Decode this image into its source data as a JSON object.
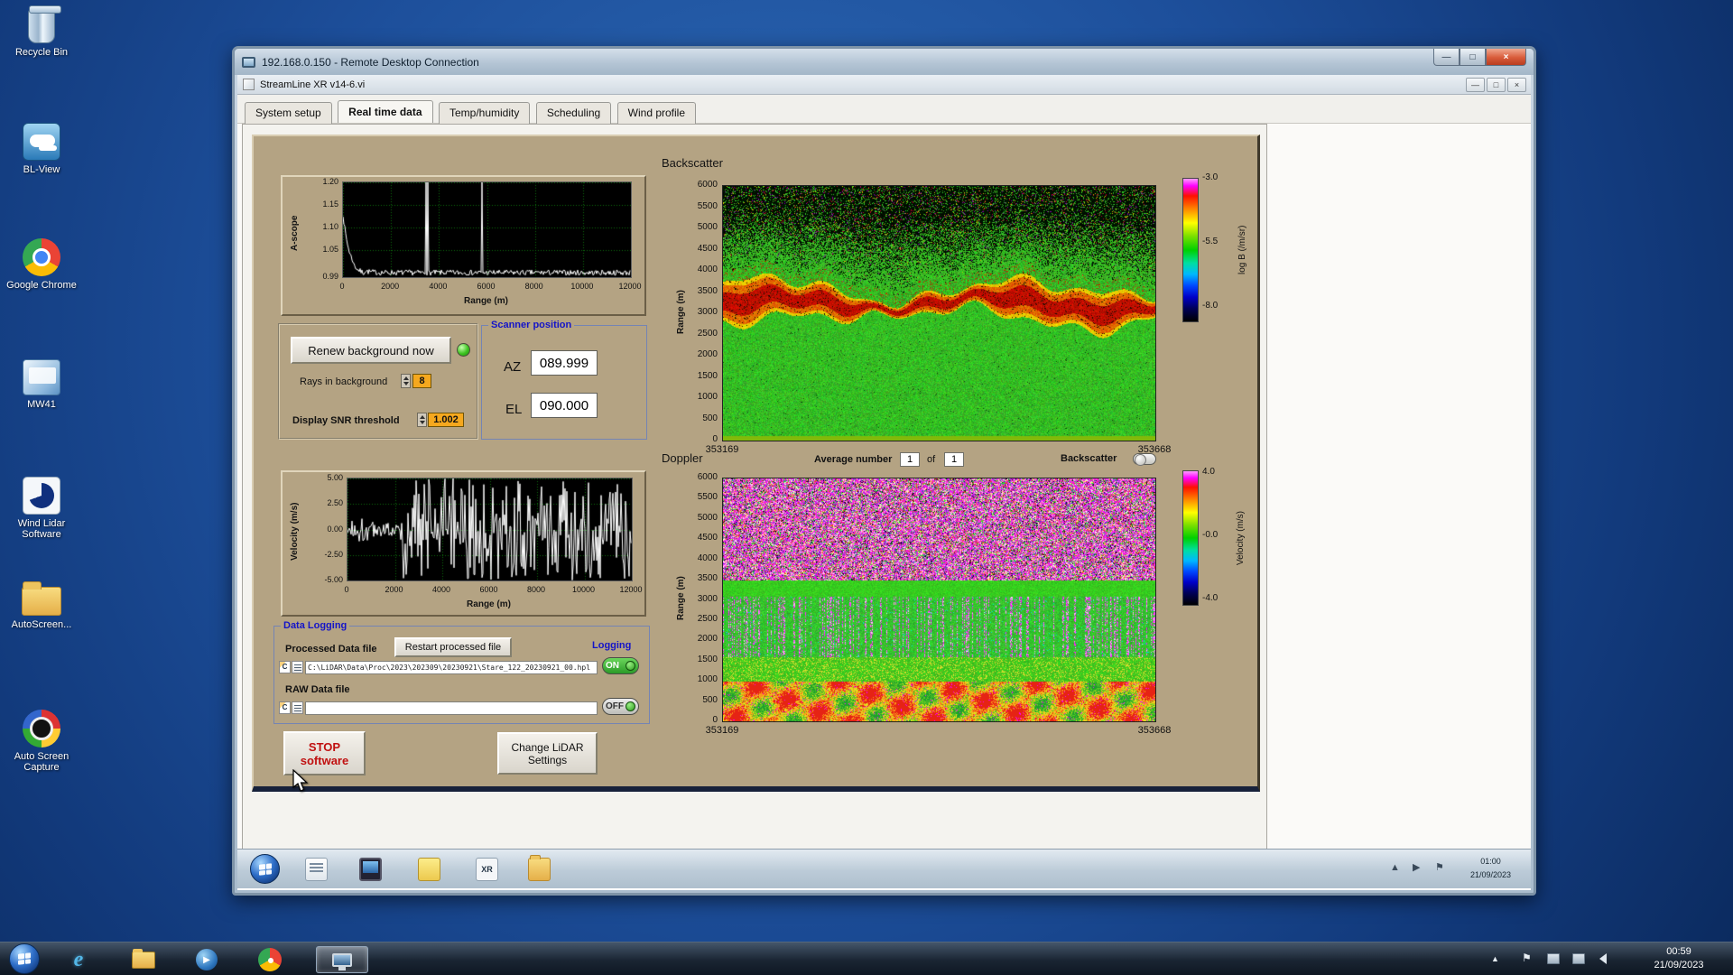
{
  "desktop": {
    "icons": [
      {
        "name": "recycle-bin",
        "label": "Recycle Bin"
      },
      {
        "name": "bl-view",
        "label": "BL-View"
      },
      {
        "name": "google-chrome",
        "label": "Google Chrome"
      },
      {
        "name": "mw41",
        "label": "MW41"
      },
      {
        "name": "wind-lidar-software",
        "label": "Wind Lidar Software"
      },
      {
        "name": "autoscreen",
        "label": "AutoScreen..."
      },
      {
        "name": "auto-screen-capture",
        "label": "Auto Screen Capture"
      }
    ]
  },
  "rdp": {
    "title": "192.168.0.150 - Remote Desktop Connection"
  },
  "app": {
    "title": "StreamLine XR v14-6.vi",
    "tabs": [
      "System setup",
      "Real time data",
      "Temp/humidity",
      "Scheduling",
      "Wind profile"
    ],
    "active_tab": "Real time data"
  },
  "glyphs": {
    "minimize": "—",
    "maximize": "□",
    "close": "×",
    "ie": "e",
    "caret": "▲",
    "flag": "⚑",
    "play": "▶"
  },
  "controls": {
    "renew_button": "Renew background now",
    "rays_label": "Rays in background",
    "rays_value": "8",
    "snr_label": "Display SNR threshold",
    "snr_value": "1.002",
    "scanner": {
      "title": "Scanner position",
      "az_label": "AZ",
      "az_value": "089.999",
      "el_label": "EL",
      "el_value": "090.000"
    },
    "doppler_bar": {
      "average_label": "Average number",
      "average_value": "1",
      "of_label": "of",
      "average_total": "1",
      "backscatter_toggle_label": "Backscatter"
    },
    "data_logging": {
      "title": "Data Logging",
      "processed_label": "Processed Data file",
      "restart_button": "Restart processed file",
      "logging_label": "Logging",
      "drive_badge": "C",
      "processed_path": "C:\\LiDAR\\Data\\Proc\\2023\\202309\\20230921\\Stare_122_20230921_00.hpl",
      "processed_toggle": "ON",
      "raw_label": "RAW Data file",
      "raw_path": "",
      "raw_toggle": "OFF"
    },
    "stop_button": "STOP software",
    "change_button": "Change LiDAR Settings"
  },
  "remote_taskbar": {
    "time": "01:00",
    "date": "21/09/2023",
    "xr_badge": "XR"
  },
  "taskbar": {
    "time": "00:59",
    "date": "21/09/2023"
  },
  "chart_data": [
    {
      "id": "ascope",
      "type": "line",
      "ylabel": "A-scope",
      "xlabel": "Range (m)",
      "ylim": [
        0.99,
        1.2
      ],
      "yticks": [
        "1.20",
        "1.15",
        "1.10",
        "1.05",
        "0.99"
      ],
      "xlim": [
        0,
        12000
      ],
      "xticks": [
        0,
        2000,
        4000,
        6000,
        8000,
        10000,
        12000
      ],
      "grid": true,
      "bg_color": "#000000",
      "line_color": "#ffffff",
      "baseline": 1.0,
      "start_value": 1.13,
      "spike_ranges_m": [
        3450,
        5800
      ],
      "series_description": "SNR A-scope: baseline ~1.00 with small noise, transient decaying from 1.13 near range 0, narrow full-scale spikes near 3450 m and 5800 m"
    },
    {
      "id": "velocity",
      "type": "line",
      "ylabel": "Velocity (m/s)",
      "xlabel": "Range (m)",
      "ylim": [
        -5,
        5
      ],
      "yticks": [
        "5.00",
        "2.50",
        "0.00",
        "-2.50",
        "-5.00"
      ],
      "xlim": [
        0,
        12000
      ],
      "xticks": [
        0,
        2000,
        4000,
        6000,
        8000,
        10000,
        12000
      ],
      "grid": true,
      "bg_color": "#000000",
      "line_color": "#ffffff",
      "quiet_below_m": 2300,
      "series_description": "Radial velocity vs range: low noise ±1 m/s below ~2300 m, noise-dominated full-scale ±5 m/s beyond"
    },
    {
      "id": "backscatter",
      "type": "heatmap",
      "title": "Backscatter",
      "ylabel": "Range (m)",
      "ylim": [
        0,
        6000
      ],
      "yticks": [
        6000,
        5500,
        5000,
        4500,
        4000,
        3500,
        3000,
        2500,
        2000,
        1500,
        1000,
        500,
        0
      ],
      "xticks": [
        "353169",
        "353668"
      ],
      "colorbar": {
        "label": "log B (/m/sr)",
        "ticks": [
          "-3.0",
          "-5.5",
          "-8.0"
        ]
      },
      "bands": [
        {
          "range_m": [
            0,
            2800
          ],
          "value": "~ -5.5 uniform aerosol return (green)"
        },
        {
          "range_m": [
            2800,
            3600
          ],
          "value": "~ -3 strong aerosol/cloud layer (red)"
        },
        {
          "range_m": [
            3600,
            4800
          ],
          "value": "green fading into speckle"
        },
        {
          "range_m": [
            4800,
            6000
          ],
          "value": "noise-dominated speckle (black/green)"
        }
      ]
    },
    {
      "id": "doppler",
      "type": "heatmap",
      "title": "Doppler",
      "ylabel": "Range (m)",
      "ylim": [
        0,
        6000
      ],
      "yticks": [
        6000,
        5500,
        5000,
        4500,
        4000,
        3500,
        3000,
        2500,
        2000,
        1500,
        1000,
        500,
        0
      ],
      "xticks": [
        "353169",
        "353668"
      ],
      "colorbar": {
        "label": "Velocity (m/s)",
        "ticks": [
          "4.0",
          "-0.0",
          "-4.0"
        ]
      },
      "bands": [
        {
          "range_m": [
            0,
            1000
          ],
          "value": "mixed velocities (yellow/orange/red/green)"
        },
        {
          "range_m": [
            1000,
            1600
          ],
          "value": "near 0 with positive patches"
        },
        {
          "range_m": [
            1600,
            3100
          ],
          "value": "near 0 (green) with magenta noise streaks"
        },
        {
          "range_m": [
            3100,
            3500
          ],
          "value": "clean near-zero band (green)"
        },
        {
          "range_m": [
            3500,
            6000
          ],
          "value": "noise-dominated (magenta/pink speckle)"
        }
      ]
    }
  ]
}
